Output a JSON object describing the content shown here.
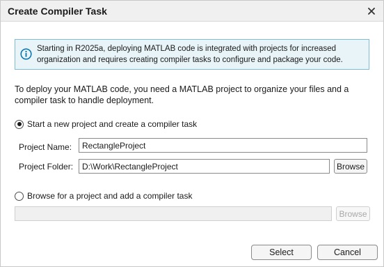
{
  "window": {
    "title": "Create Compiler Task"
  },
  "info": {
    "text": "Starting in R2025a, deploying MATLAB code is integrated with projects for increased organization and requires creating compiler tasks to configure and package your code.",
    "accent_color": "#0073ae",
    "icon": "info-icon"
  },
  "intro": {
    "text": "To deploy your MATLAB code, you need a MATLAB project to organize your files and a compiler task to handle deployment."
  },
  "option_new": {
    "label": "Start a new project and create a compiler task",
    "selected": true,
    "project_name_label": "Project Name:",
    "project_name_value": "RectangleProject",
    "project_folder_label": "Project Folder:",
    "project_folder_value": "D:\\Work\\RectangleProject",
    "browse_label": "Browse"
  },
  "option_existing": {
    "label": "Browse for a project and add a compiler task",
    "selected": false,
    "path_value": "",
    "browse_label": "Browse"
  },
  "footer": {
    "select_label": "Select",
    "cancel_label": "Cancel"
  }
}
